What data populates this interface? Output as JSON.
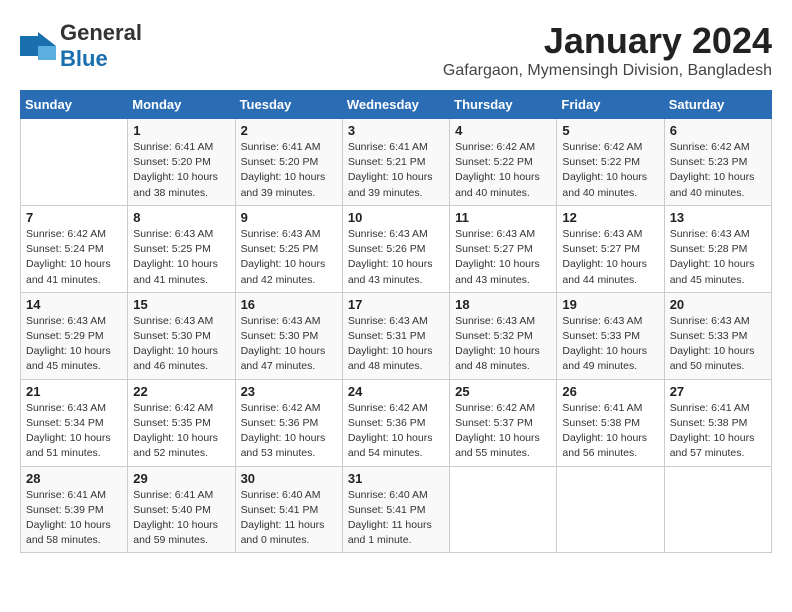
{
  "header": {
    "logo_general": "General",
    "logo_blue": "Blue",
    "month_title": "January 2024",
    "location": "Gafargaon, Mymensingh Division, Bangladesh"
  },
  "days_of_week": [
    "Sunday",
    "Monday",
    "Tuesday",
    "Wednesday",
    "Thursday",
    "Friday",
    "Saturday"
  ],
  "weeks": [
    [
      {
        "date": "",
        "info": ""
      },
      {
        "date": "1",
        "info": "Sunrise: 6:41 AM\nSunset: 5:20 PM\nDaylight: 10 hours\nand 38 minutes."
      },
      {
        "date": "2",
        "info": "Sunrise: 6:41 AM\nSunset: 5:20 PM\nDaylight: 10 hours\nand 39 minutes."
      },
      {
        "date": "3",
        "info": "Sunrise: 6:41 AM\nSunset: 5:21 PM\nDaylight: 10 hours\nand 39 minutes."
      },
      {
        "date": "4",
        "info": "Sunrise: 6:42 AM\nSunset: 5:22 PM\nDaylight: 10 hours\nand 40 minutes."
      },
      {
        "date": "5",
        "info": "Sunrise: 6:42 AM\nSunset: 5:22 PM\nDaylight: 10 hours\nand 40 minutes."
      },
      {
        "date": "6",
        "info": "Sunrise: 6:42 AM\nSunset: 5:23 PM\nDaylight: 10 hours\nand 40 minutes."
      }
    ],
    [
      {
        "date": "7",
        "info": "Sunrise: 6:42 AM\nSunset: 5:24 PM\nDaylight: 10 hours\nand 41 minutes."
      },
      {
        "date": "8",
        "info": "Sunrise: 6:43 AM\nSunset: 5:25 PM\nDaylight: 10 hours\nand 41 minutes."
      },
      {
        "date": "9",
        "info": "Sunrise: 6:43 AM\nSunset: 5:25 PM\nDaylight: 10 hours\nand 42 minutes."
      },
      {
        "date": "10",
        "info": "Sunrise: 6:43 AM\nSunset: 5:26 PM\nDaylight: 10 hours\nand 43 minutes."
      },
      {
        "date": "11",
        "info": "Sunrise: 6:43 AM\nSunset: 5:27 PM\nDaylight: 10 hours\nand 43 minutes."
      },
      {
        "date": "12",
        "info": "Sunrise: 6:43 AM\nSunset: 5:27 PM\nDaylight: 10 hours\nand 44 minutes."
      },
      {
        "date": "13",
        "info": "Sunrise: 6:43 AM\nSunset: 5:28 PM\nDaylight: 10 hours\nand 45 minutes."
      }
    ],
    [
      {
        "date": "14",
        "info": "Sunrise: 6:43 AM\nSunset: 5:29 PM\nDaylight: 10 hours\nand 45 minutes."
      },
      {
        "date": "15",
        "info": "Sunrise: 6:43 AM\nSunset: 5:30 PM\nDaylight: 10 hours\nand 46 minutes."
      },
      {
        "date": "16",
        "info": "Sunrise: 6:43 AM\nSunset: 5:30 PM\nDaylight: 10 hours\nand 47 minutes."
      },
      {
        "date": "17",
        "info": "Sunrise: 6:43 AM\nSunset: 5:31 PM\nDaylight: 10 hours\nand 48 minutes."
      },
      {
        "date": "18",
        "info": "Sunrise: 6:43 AM\nSunset: 5:32 PM\nDaylight: 10 hours\nand 48 minutes."
      },
      {
        "date": "19",
        "info": "Sunrise: 6:43 AM\nSunset: 5:33 PM\nDaylight: 10 hours\nand 49 minutes."
      },
      {
        "date": "20",
        "info": "Sunrise: 6:43 AM\nSunset: 5:33 PM\nDaylight: 10 hours\nand 50 minutes."
      }
    ],
    [
      {
        "date": "21",
        "info": "Sunrise: 6:43 AM\nSunset: 5:34 PM\nDaylight: 10 hours\nand 51 minutes."
      },
      {
        "date": "22",
        "info": "Sunrise: 6:42 AM\nSunset: 5:35 PM\nDaylight: 10 hours\nand 52 minutes."
      },
      {
        "date": "23",
        "info": "Sunrise: 6:42 AM\nSunset: 5:36 PM\nDaylight: 10 hours\nand 53 minutes."
      },
      {
        "date": "24",
        "info": "Sunrise: 6:42 AM\nSunset: 5:36 PM\nDaylight: 10 hours\nand 54 minutes."
      },
      {
        "date": "25",
        "info": "Sunrise: 6:42 AM\nSunset: 5:37 PM\nDaylight: 10 hours\nand 55 minutes."
      },
      {
        "date": "26",
        "info": "Sunrise: 6:41 AM\nSunset: 5:38 PM\nDaylight: 10 hours\nand 56 minutes."
      },
      {
        "date": "27",
        "info": "Sunrise: 6:41 AM\nSunset: 5:38 PM\nDaylight: 10 hours\nand 57 minutes."
      }
    ],
    [
      {
        "date": "28",
        "info": "Sunrise: 6:41 AM\nSunset: 5:39 PM\nDaylight: 10 hours\nand 58 minutes."
      },
      {
        "date": "29",
        "info": "Sunrise: 6:41 AM\nSunset: 5:40 PM\nDaylight: 10 hours\nand 59 minutes."
      },
      {
        "date": "30",
        "info": "Sunrise: 6:40 AM\nSunset: 5:41 PM\nDaylight: 11 hours\nand 0 minutes."
      },
      {
        "date": "31",
        "info": "Sunrise: 6:40 AM\nSunset: 5:41 PM\nDaylight: 11 hours\nand 1 minute."
      },
      {
        "date": "",
        "info": ""
      },
      {
        "date": "",
        "info": ""
      },
      {
        "date": "",
        "info": ""
      }
    ]
  ]
}
